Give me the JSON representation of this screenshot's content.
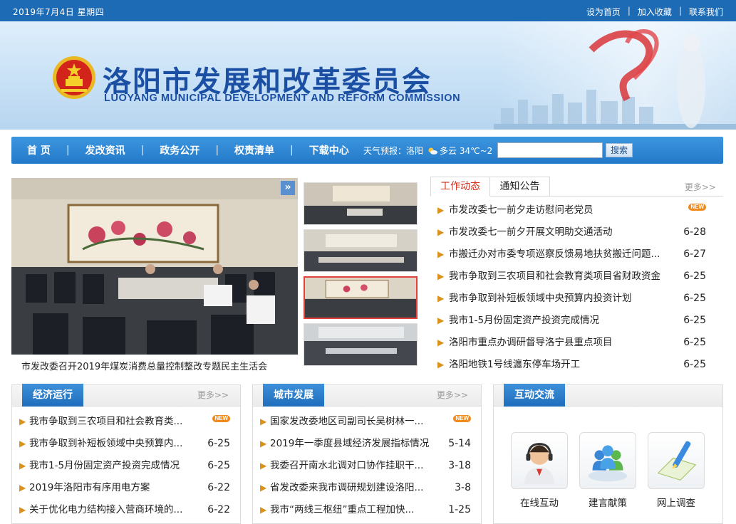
{
  "topbar": {
    "date": "2019年7月4日  星期四",
    "links": [
      "设为首页",
      "加入收藏",
      "联系我们"
    ]
  },
  "brand": {
    "name_cn": "洛阳市发展和改革委员会",
    "name_en": "LUOYANG MUNICIPAL DEVELOPMENT AND REFORM COMMISSION"
  },
  "nav": {
    "items": [
      "首 页",
      "发改资讯",
      "政务公开",
      "权责清单",
      "下载中心"
    ],
    "weather_label": "天气预报：洛阳",
    "weather_value": "多云 34℃~2",
    "search_placeholder": "",
    "search_button": "搜索"
  },
  "slideshow": {
    "caption": "市发改委召开2019年煤炭消费总量控制整改专题民主生活会",
    "arrow": "»",
    "active_thumb_index": 2
  },
  "news": {
    "tabs": [
      "工作动态",
      "通知公告"
    ],
    "more": "更多>>",
    "items": [
      {
        "title": "市发改委七一前夕走访慰问老党员",
        "date": "",
        "new": true
      },
      {
        "title": "市发改委七一前夕开展文明助交通活动",
        "date": "6-28",
        "new": false
      },
      {
        "title": "市搬迁办对市委专项巡察反馈易地扶贫搬迁问题...",
        "date": "6-27",
        "new": false
      },
      {
        "title": "我市争取到三农项目和社会教育类项目省财政资金",
        "date": "6-25",
        "new": false
      },
      {
        "title": "我市争取到补短板领域中央预算内投资计划",
        "date": "6-25",
        "new": false
      },
      {
        "title": "我市1-5月份固定资产投资完成情况",
        "date": "6-25",
        "new": false
      },
      {
        "title": "洛阳市重点办调研督导洛宁县重点项目",
        "date": "6-25",
        "new": false
      },
      {
        "title": "洛阳地铁1号线瀍东停车场开工",
        "date": "6-25",
        "new": false
      }
    ],
    "new_tag": "NEW"
  },
  "economy": {
    "title": "经济运行",
    "more": "更多>>",
    "items": [
      {
        "title": "我市争取到三农项目和社会教育类...",
        "date": "",
        "new": true
      },
      {
        "title": "我市争取到补短板领域中央预算内...",
        "date": "6-25",
        "new": false
      },
      {
        "title": "我市1-5月份固定资产投资完成情况",
        "date": "6-25",
        "new": false
      },
      {
        "title": "2019年洛阳市有序用电方案",
        "date": "6-22",
        "new": false
      },
      {
        "title": "关于优化电力结构接入营商环境的...",
        "date": "6-22",
        "new": false
      }
    ]
  },
  "city": {
    "title": "城市发展",
    "more": "更多>>",
    "items": [
      {
        "title": "国家发改委地区司副司长吴树林一...",
        "date": "",
        "new": true
      },
      {
        "title": "2019年一季度县域经济发展指标情况",
        "date": "5-14",
        "new": false
      },
      {
        "title": "我委召开南水北调对口协作挂职干...",
        "date": "3-18",
        "new": false
      },
      {
        "title": "省发改委来我市调研规划建设洛阳...",
        "date": "3-8",
        "new": false
      },
      {
        "title": "我市“两线三枢纽”重点工程加快...",
        "date": "1-25",
        "new": false
      }
    ]
  },
  "interaction": {
    "title": "互动交流",
    "items": [
      "在线互动",
      "建言献策",
      "网上调查"
    ]
  },
  "colors": {
    "topbar": "#1c6bb4",
    "nav": "#2a80cf",
    "brand": "#1b4fa3",
    "accent_red": "#d3331f",
    "bullet": "#d9921c"
  }
}
